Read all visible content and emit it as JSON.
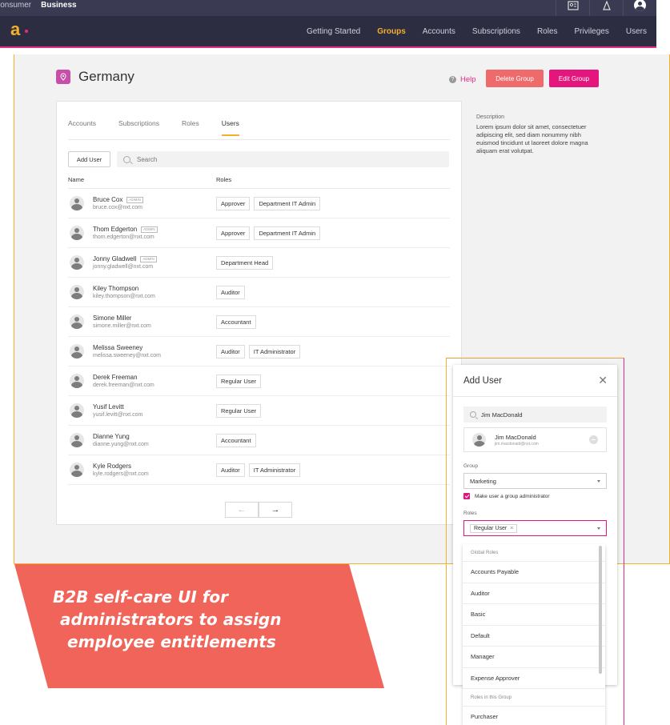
{
  "topbar": {
    "tabs": [
      {
        "label": "Consumer"
      },
      {
        "label": "Business"
      }
    ]
  },
  "nav": {
    "items": [
      {
        "label": "Getting Started"
      },
      {
        "label": "Groups"
      },
      {
        "label": "Accounts"
      },
      {
        "label": "Subscriptions"
      },
      {
        "label": "Roles"
      },
      {
        "label": "Privileges"
      },
      {
        "label": "Users"
      }
    ],
    "active": "Groups"
  },
  "page": {
    "title": "Germany",
    "help_label": "Help",
    "delete_label": "Delete Group",
    "edit_label": "Edit Group"
  },
  "tabs": [
    {
      "label": "Accounts"
    },
    {
      "label": "Subscriptions"
    },
    {
      "label": "Roles"
    },
    {
      "label": "Users"
    }
  ],
  "toolbar": {
    "add_user_label": "Add User",
    "search_placeholder": "Search"
  },
  "table": {
    "col_name": "Name",
    "col_roles": "Roles",
    "rows": [
      {
        "name": "Bruce Cox",
        "badge": "ADMIN",
        "email": "bruce.cox@nxt.com",
        "roles": [
          "Approver",
          "Department IT Admin"
        ]
      },
      {
        "name": "Thom Edgerton",
        "badge": "ADMIN",
        "email": "thom.edgerton@nxt.com",
        "roles": [
          "Approver",
          "Department IT Admin"
        ]
      },
      {
        "name": "Jonny Gladwell",
        "badge": "ADMIN",
        "email": "jonny.gladwell@nxt.com",
        "roles": [
          "Department Head"
        ]
      },
      {
        "name": "Kiley Thompson",
        "badge": "",
        "email": "kiley.thompson@nxt.com",
        "roles": [
          "Auditor"
        ]
      },
      {
        "name": "Simone Miller",
        "badge": "",
        "email": "simone.miller@nxt.com",
        "roles": [
          "Accountant"
        ]
      },
      {
        "name": "Melissa Sweeney",
        "badge": "",
        "email": "melissa.sweeney@nxt.com",
        "roles": [
          "Auditor",
          "IT Administrator"
        ]
      },
      {
        "name": "Derek Freeman",
        "badge": "",
        "email": "derek.freeman@nxt.com",
        "roles": [
          "Regular User"
        ]
      },
      {
        "name": "Yusif Levitt",
        "badge": "",
        "email": "yusif.levitt@nxt.com",
        "roles": [
          "Regular User"
        ]
      },
      {
        "name": "Dianne Yung",
        "badge": "",
        "email": "dianne.yung@nxt.com",
        "roles": [
          "Accountant"
        ]
      },
      {
        "name": "Kyle Rodgers",
        "badge": "",
        "email": "kyle.rodgers@nxt.com",
        "roles": [
          "Auditor",
          "IT Administrator"
        ]
      }
    ]
  },
  "pager": {
    "prev": "←",
    "next": "→"
  },
  "description": {
    "label": "Description",
    "text": "Lorem ipsum dolor sit amet, consectetuer adipiscing elit, sed diam nonummy nibh euismod tincidunt ut laoreet dolore magna aliquam erat volutpat."
  },
  "add_user": {
    "title": "Add User",
    "close": "✕",
    "search_value": "Jim MacDonald",
    "result_name": "Jim MacDonald",
    "result_email": "jim.macdonald@nxt.com",
    "group_label": "Group",
    "group_value": "Marketing",
    "admin_checkbox_label": "Make user a group administrator",
    "roles_label": "Roles",
    "roles_tag": "Regular User",
    "tag_remove": "×",
    "dropdown": {
      "global_header": "Global Roles",
      "global_items": [
        "Accounts Payable",
        "Auditor",
        "Basic",
        "Default",
        "Manager",
        "Expense Approver"
      ],
      "group_header": "Roles in this Group",
      "group_items": [
        "Purchaser"
      ]
    }
  },
  "banner": {
    "lines": [
      "B2B self-care UI for",
      "administrators to assign",
      "employee entitlements"
    ],
    "color": "#f0645a"
  },
  "colors": {
    "accent_magenta": "#e5157e",
    "accent_orange": "#f2b12e",
    "delete_red": "#ef6b6b",
    "nav_bg": "#2d2d42"
  }
}
